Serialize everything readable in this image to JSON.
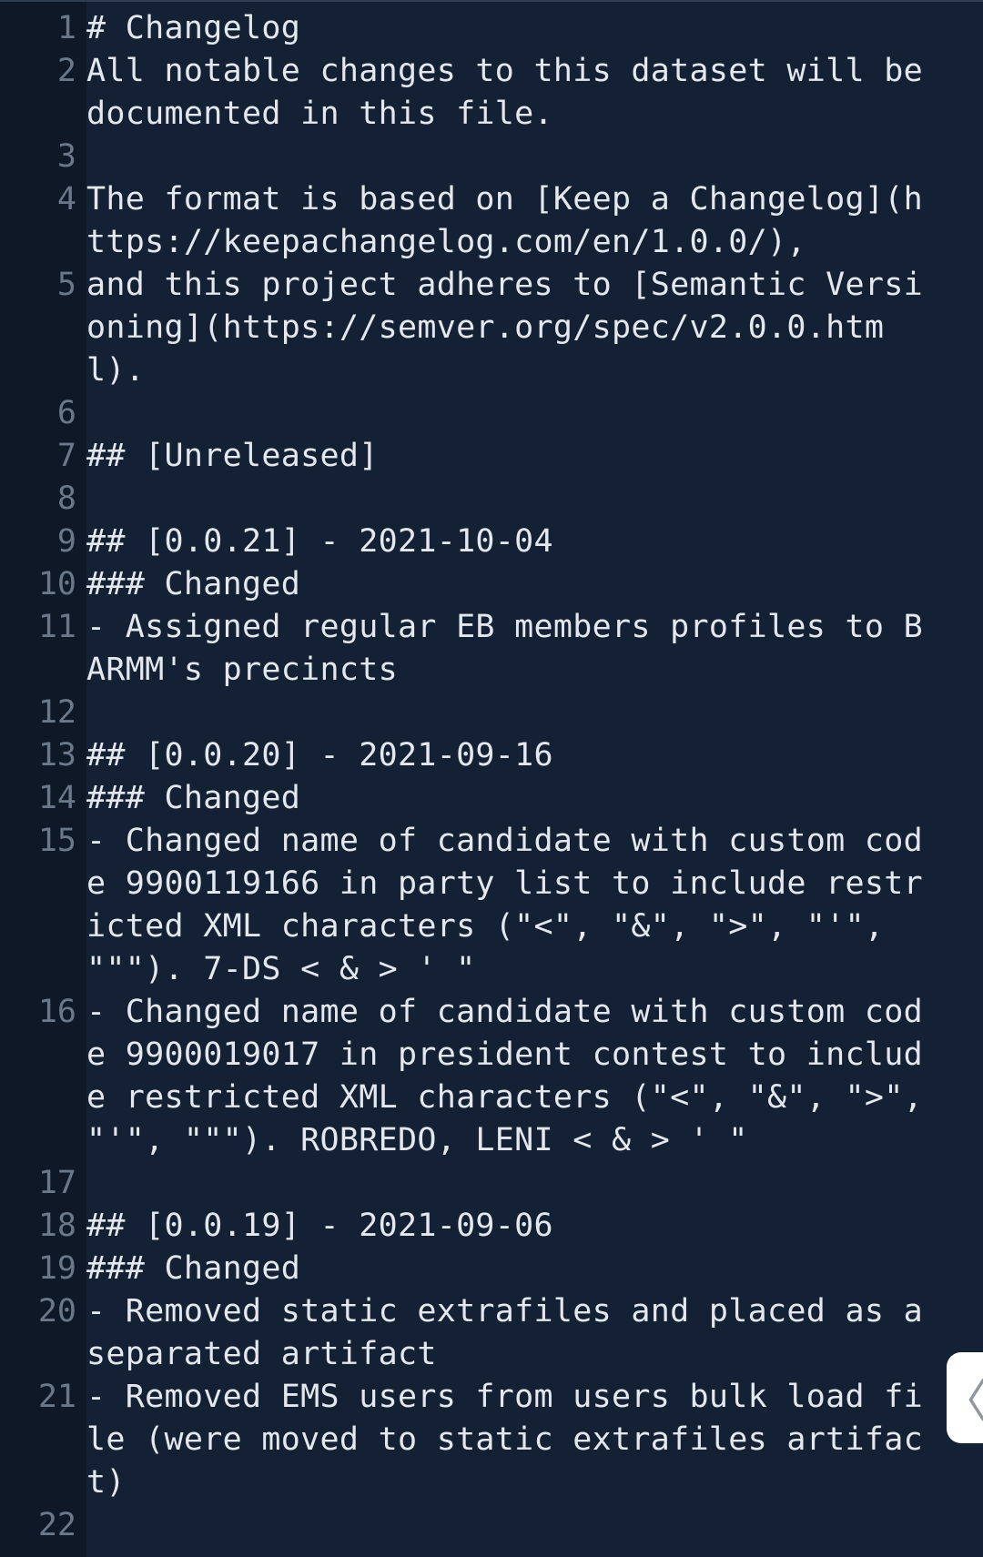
{
  "editor": {
    "lines": [
      {
        "n": "1",
        "text": "# Changelog"
      },
      {
        "n": "2",
        "text": "All notable changes to this dataset will be documented in this file."
      },
      {
        "n": "3",
        "text": ""
      },
      {
        "n": "4",
        "text": "The format is based on [Keep a Changelog](https://keepachangelog.com/en/1.0.0/),"
      },
      {
        "n": "5",
        "text": "and this project adheres to [Semantic Versioning](https://semver.org/spec/v2.0.0.html)."
      },
      {
        "n": "6",
        "text": ""
      },
      {
        "n": "7",
        "text": "## [Unreleased]"
      },
      {
        "n": "8",
        "text": ""
      },
      {
        "n": "9",
        "text": "## [0.0.21] - 2021-10-04"
      },
      {
        "n": "10",
        "text": "### Changed"
      },
      {
        "n": "11",
        "text": "- Assigned regular EB members profiles to BARMM's precincts"
      },
      {
        "n": "12",
        "text": ""
      },
      {
        "n": "13",
        "text": "## [0.0.20] - 2021-09-16"
      },
      {
        "n": "14",
        "text": "### Changed"
      },
      {
        "n": "15",
        "text": "- Changed name of candidate with custom code 9900119166 in party list to include restricted XML characters (\"<\", \"&\", \">\", \"'\", \"\"\"). 7-DS < & > ' \""
      },
      {
        "n": "16",
        "text": "- Changed name of candidate with custom code 9900019017 in president contest to include restricted XML characters (\"<\", \"&\", \">\", \"'\", \"\"\"). ROBREDO, LENI < & > ' \""
      },
      {
        "n": "17",
        "text": ""
      },
      {
        "n": "18",
        "text": "## [0.0.19] - 2021-09-06"
      },
      {
        "n": "19",
        "text": "### Changed"
      },
      {
        "n": "20",
        "text": "- Removed static extrafiles and placed as a separated artifact"
      },
      {
        "n": "21",
        "text": "- Removed EMS users from users bulk load file (were moved to static extrafiles artifact)"
      },
      {
        "n": "22",
        "text": ""
      }
    ]
  },
  "collapse_tab": {
    "icon": "chevron-left-icon",
    "glyph": "〈"
  }
}
